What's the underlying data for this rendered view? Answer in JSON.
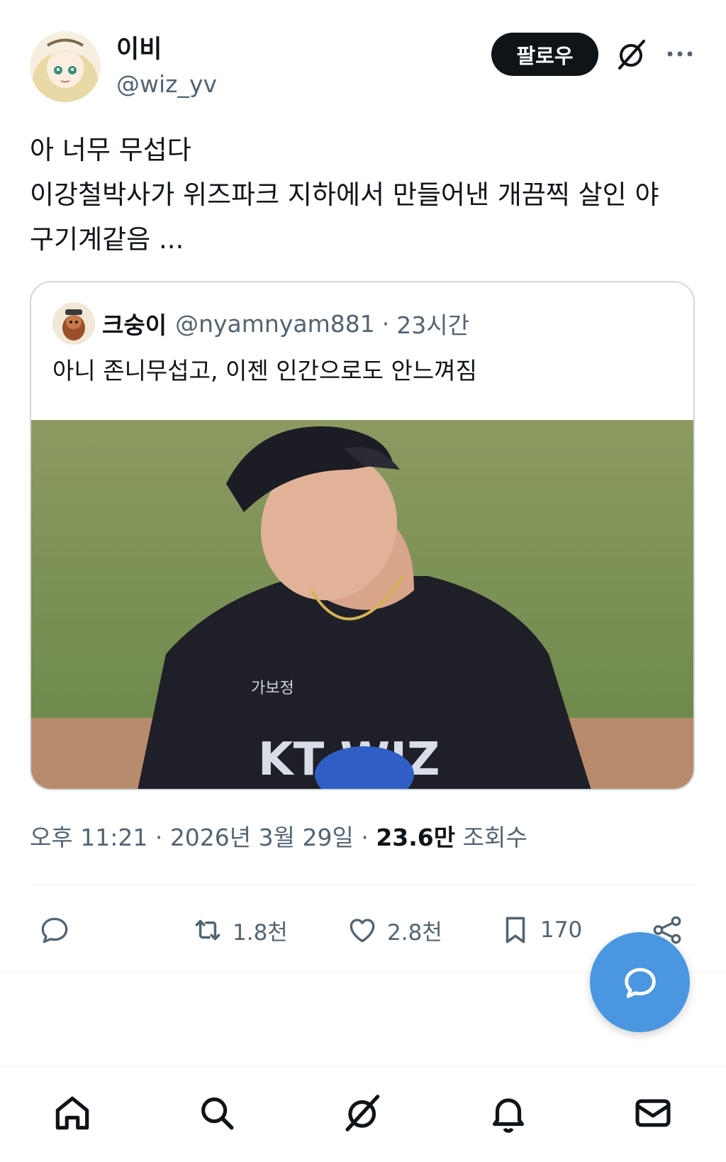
{
  "author": {
    "display_name": "이비",
    "handle": "@wiz_yv"
  },
  "header": {
    "follow_label": "팔로우",
    "grok_icon": "grok-slash-circle-icon",
    "more_icon": "more-horizontal-icon"
  },
  "tweet": {
    "lines": [
      "아 너무 무섭다",
      "이강철박사가 위즈파크 지하에서 만들어낸 개끔찍 살인 야",
      "구기계같음 ..."
    ]
  },
  "quote": {
    "display_name": "크숭이",
    "handle": "@nyamnyam881",
    "separator": "·",
    "time": "23시간",
    "text": "아니 존니무섭고, 이젠 인간으로도 안느껴짐",
    "image_alt_colors": {
      "field": "#6f8a4c",
      "dirt": "#b98b6d",
      "jersey": "#1e1f27"
    }
  },
  "meta": {
    "time": "오후 11:21",
    "separator": "·",
    "date": "2026년 3월 29일",
    "views_count": "23.6만",
    "views_label": "조회수"
  },
  "actions": {
    "reply_icon": "reply-bubble-icon",
    "retweet_count": "1.8천",
    "like_count": "2.8천",
    "bookmark_count": "170",
    "share_icon": "share-icon"
  },
  "fab": {
    "icon": "compose-reply-icon",
    "color": "#4a97e0"
  },
  "bottom_nav": [
    "home-icon",
    "search-icon",
    "grok-icon",
    "notifications-icon",
    "messages-icon"
  ]
}
